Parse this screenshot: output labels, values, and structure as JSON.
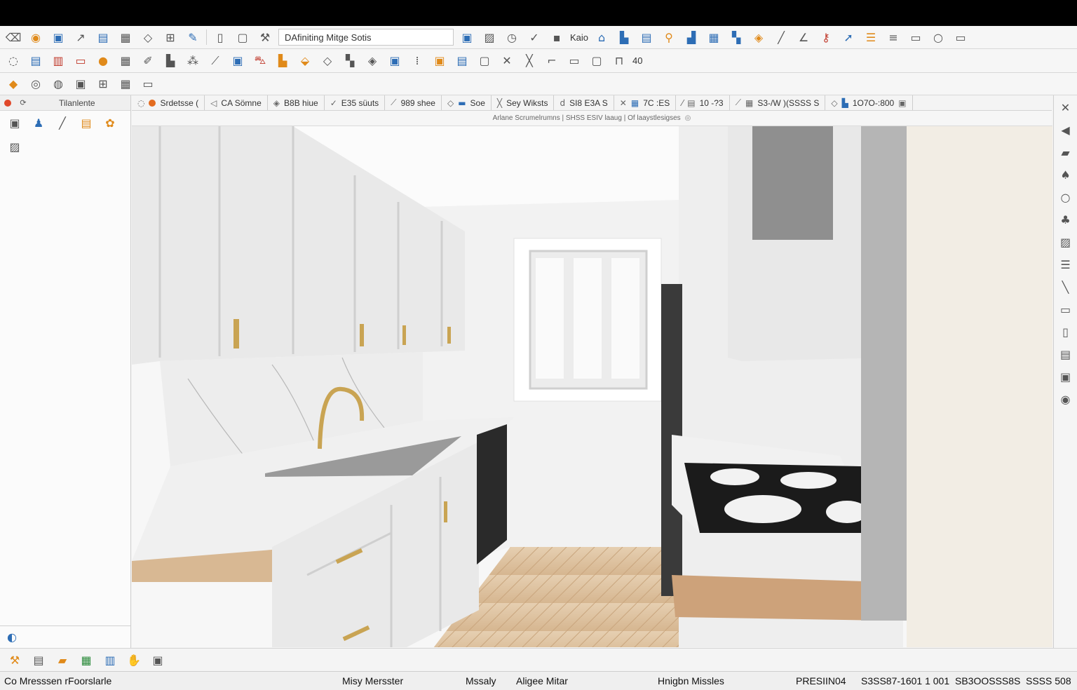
{
  "toolbar1": {
    "document_title": "DAfiniting Mitge Sotis",
    "label_right": "Kaio",
    "icons_left": [
      "eraser-icon",
      "open-folder-icon",
      "save-icon",
      "pointer-icon",
      "ruler-icon",
      "image-icon",
      "diamond-icon",
      "window-icon",
      "pen-icon"
    ],
    "icons_mid": [
      "document-icon",
      "frame-icon",
      "tool-icon"
    ],
    "icons_right": [
      "copy-icon",
      "frame-icon",
      "clock-icon",
      "check-icon",
      "square-icon"
    ],
    "icons_far": [
      "home-icon",
      "building-icon",
      "box-icon",
      "magnify-icon",
      "stairs-icon",
      "window-tool-icon",
      "door-icon",
      "layers-icon",
      "pencil-icon",
      "angle-icon",
      "key-icon",
      "cursor-icon",
      "text-icon",
      "align-icon",
      "panel-icon",
      "circle-icon",
      "panel2-icon"
    ]
  },
  "toolbar2": {
    "label_end": "40",
    "icons": [
      "reload-icon",
      "layers-icon",
      "save-red-icon",
      "rect-orange-icon",
      "bulb-icon",
      "grid-icon",
      "pencil-icon",
      "paste-icon",
      "group-icon",
      "roll-icon",
      "select-icon",
      "car-icon",
      "home-orange-icon",
      "mark-icon",
      "cube-icon",
      "pattern-icon",
      "photo-icon",
      "lines-icon",
      "palette-icon",
      "frame-blue-icon",
      "square-icon",
      "cross-icon",
      "cross2-icon",
      "corner-icon",
      "square2-icon",
      "square3-icon",
      "square4-icon"
    ]
  },
  "toolbar3": {
    "icons": [
      "pen-tool-icon",
      "spiral-icon",
      "shell-icon",
      "gear-image-icon",
      "grid-image-icon",
      "photo2-icon",
      "photo3-icon"
    ]
  },
  "left_panel": {
    "title": "Tilanlente",
    "icons": [
      "monitor-icon",
      "person-icon",
      "pen-icon",
      "folder-icon",
      "fish-icon",
      "painting-icon"
    ],
    "footer_icon": "globe-icon"
  },
  "options_bar": {
    "items": [
      {
        "icon": "circle-icon",
        "label": "Srdetsse (",
        "dot": true
      },
      {
        "icon": "arrow-icon",
        "label": "CA Sömne"
      },
      {
        "icon": "diamond-icon",
        "label": "B8B hiue"
      },
      {
        "icon": "check-icon",
        "label": "E35 süuts"
      },
      {
        "icon": "pen-icon",
        "label": "989 shee"
      },
      {
        "icon": "chevron-icon",
        "label": "Soe"
      },
      {
        "icon": "cross-icon",
        "label": "Sey Wiksts"
      },
      {
        "icon": "d-icon",
        "label": "SI8 E3A S"
      },
      {
        "icon": "x-icon",
        "label": "7C :ES"
      },
      {
        "icon": "slash-icon",
        "label": "10 -?3"
      },
      {
        "icon": "angle-icon",
        "label": "S3-/W )(SSSS S"
      },
      {
        "icon": "diamond-icon",
        "label": "1O7O-:800"
      }
    ],
    "close_icon": "close-icon"
  },
  "view_caption": "Arlane Scrumelrumns | SHSS ESIV laaug | Of laaystlesigses",
  "right_tools": [
    "back-arrow-icon",
    "ruler-orange-icon",
    "paint-icon",
    "circle-icon",
    "plant-icon",
    "texture-icon",
    "stack-icon",
    "line-icon",
    "panel-icon",
    "cabinet-icon",
    "window-grid-icon",
    "camera-icon",
    "eye-icon"
  ],
  "bottom_tools": [
    "hammer-icon",
    "document-icon",
    "folder-icon",
    "sheet-icon",
    "book-icon",
    "hand-icon",
    "printer-icon"
  ],
  "status": {
    "left": "Co Mresssen rFoorslarle",
    "s1": "Misy Mersster",
    "s2": "Mssaly",
    "s3": "Aligee Mitar",
    "s4": "Hnigbn Missles",
    "s5": "PRESIIN04",
    "s6": "S3SS87-1601 1 001",
    "s7": "SB3OOSSS8S",
    "s8": "SSSS 508"
  },
  "colors": {
    "cabinet": "#e9e9e9",
    "handle_brass": "#c9a453",
    "wood": "#d8b893",
    "cooktop": "#1b1b1b",
    "accent_blue": "#2d6db5",
    "accent_orange": "#e08a1a"
  }
}
